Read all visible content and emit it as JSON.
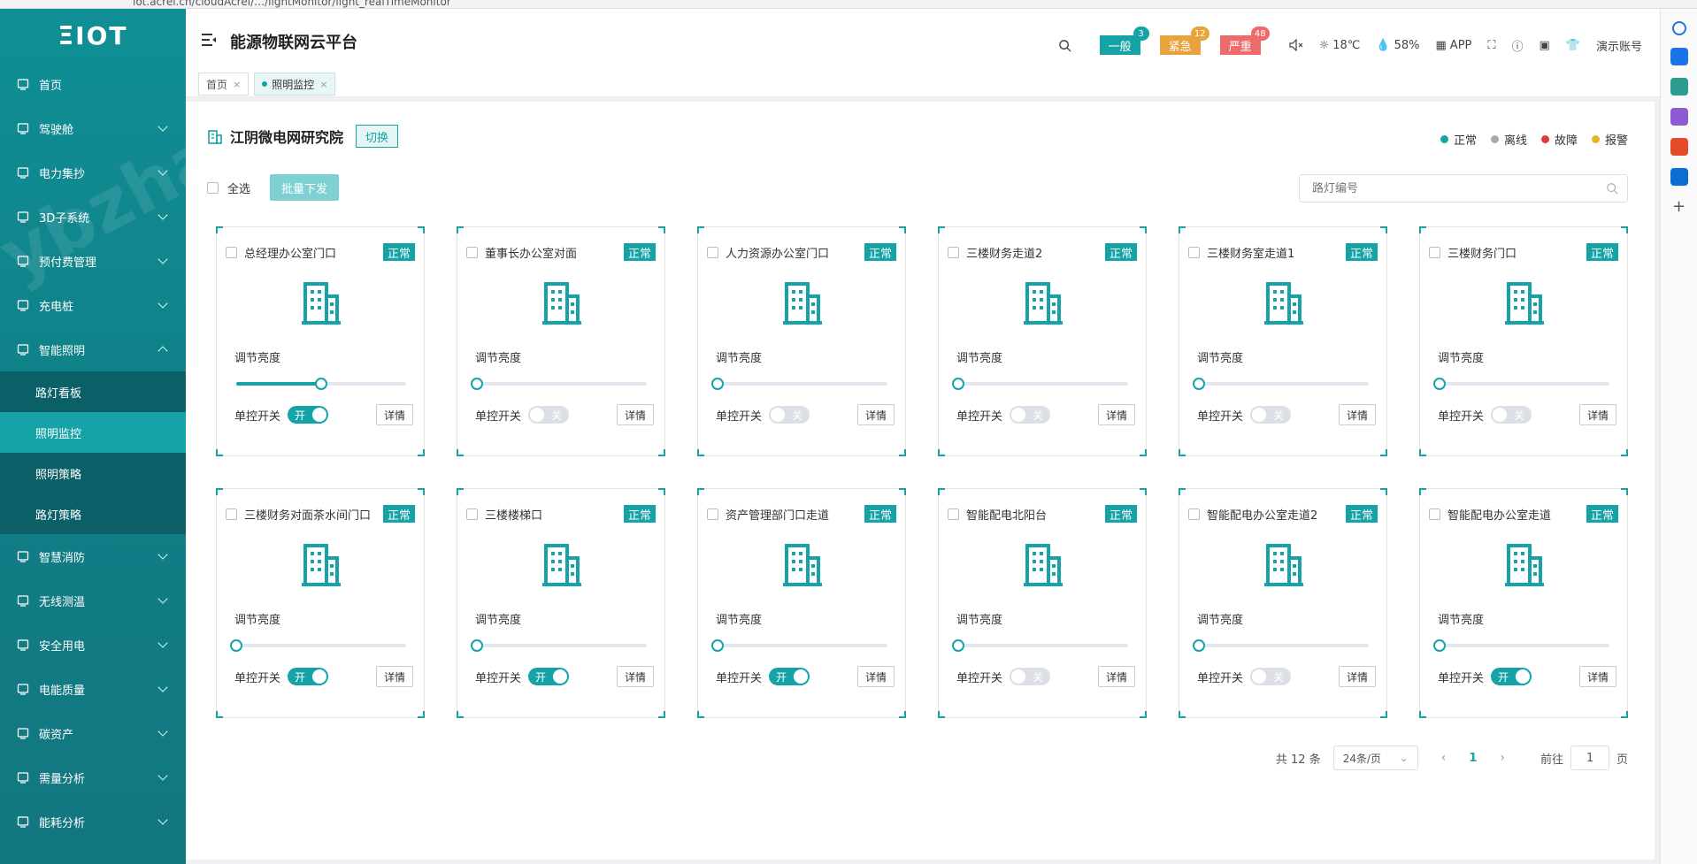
{
  "browser": {
    "url": "iot.acrel.cn/cloudAcrel/…/lightMonitor/light_realTimeMonitor"
  },
  "sidebar": {
    "logo": "ΞIOT",
    "items": [
      {
        "label": "首页",
        "icon": "monitor-icon",
        "has_children": false
      },
      {
        "label": "驾驶舱",
        "icon": "dashboard-icon",
        "has_children": true
      },
      {
        "label": "电力集抄",
        "icon": "meter-icon",
        "has_children": true
      },
      {
        "label": "3D子系统",
        "icon": "cube-icon",
        "has_children": true
      },
      {
        "label": "预付费管理",
        "icon": "user-pay-icon",
        "has_children": true
      },
      {
        "label": "充电桩",
        "icon": "charger-icon",
        "has_children": true
      },
      {
        "label": "智能照明",
        "icon": "bulb-icon",
        "has_children": true,
        "expanded": true
      }
    ],
    "sub_items": [
      {
        "label": "路灯看板",
        "active": false
      },
      {
        "label": "照明监控",
        "active": true
      },
      {
        "label": "照明策略",
        "active": false
      },
      {
        "label": "路灯策略",
        "active": false
      }
    ],
    "items_after": [
      {
        "label": "智慧消防",
        "icon": "fire-icon"
      },
      {
        "label": "无线测温",
        "icon": "thermometer-icon"
      },
      {
        "label": "安全用电",
        "icon": "flame-icon"
      },
      {
        "label": "电能质量",
        "icon": "wave-icon"
      },
      {
        "label": "碳资产",
        "icon": "carbon-icon"
      },
      {
        "label": "需量分析",
        "icon": "trend-icon"
      },
      {
        "label": "能耗分析",
        "icon": "bars-icon"
      }
    ]
  },
  "header": {
    "title": "能源物联网云平台",
    "tabs": [
      {
        "label": "首页",
        "active": false
      },
      {
        "label": "照明监控",
        "active": true
      }
    ],
    "alarms": [
      {
        "label": "一般",
        "count": "3",
        "color": "#16a3a8",
        "badge": "#16a3a8"
      },
      {
        "label": "紧急",
        "count": "12",
        "color": "#e8a33d",
        "badge": "#e8a33d"
      },
      {
        "label": "严重",
        "count": "48",
        "color": "#ef6b6b",
        "badge": "#ef6b6b"
      }
    ],
    "temperature": "18℃",
    "humidity": "58%",
    "app_label": "APP",
    "account": "演示账号"
  },
  "content": {
    "site_name": "江阴微电网研究院",
    "switch_label": "切换",
    "legend": [
      {
        "label": "正常",
        "color": "#16a3a8"
      },
      {
        "label": "离线",
        "color": "#aaaaaa"
      },
      {
        "label": "故障",
        "color": "#e23a3a"
      },
      {
        "label": "报警",
        "color": "#e8b320"
      }
    ],
    "select_all": "全选",
    "batch_button": "批量下发",
    "search_placeholder": "路灯编号",
    "brightness_label": "调节亮度",
    "switch_control_label": "单控开关",
    "detail_label": "详情",
    "on_text": "开",
    "off_text": "关",
    "lamps": [
      {
        "name": "总经理办公室门口",
        "status": "正常",
        "brightness": 50,
        "on": true
      },
      {
        "name": "董事长办公室对面",
        "status": "正常",
        "brightness": 0,
        "on": false
      },
      {
        "name": "人力资源办公室门口",
        "status": "正常",
        "brightness": 0,
        "on": false
      },
      {
        "name": "三楼财务走道2",
        "status": "正常",
        "brightness": 0,
        "on": false
      },
      {
        "name": "三楼财务室走道1",
        "status": "正常",
        "brightness": 0,
        "on": false
      },
      {
        "name": "三楼财务门口",
        "status": "正常",
        "brightness": 0,
        "on": false
      },
      {
        "name": "三楼财务对面茶水间门口",
        "status": "正常",
        "brightness": 0,
        "on": true
      },
      {
        "name": "三楼楼梯口",
        "status": "正常",
        "brightness": 0,
        "on": true
      },
      {
        "name": "资产管理部门口走道",
        "status": "正常",
        "brightness": 0,
        "on": true
      },
      {
        "name": "智能配电北阳台",
        "status": "正常",
        "brightness": 0,
        "on": false
      },
      {
        "name": "智能配电办公室走道2",
        "status": "正常",
        "brightness": 0,
        "on": false
      },
      {
        "name": "智能配电办公室走道",
        "status": "正常",
        "brightness": 0,
        "on": true
      }
    ],
    "pager": {
      "total": "共 12 条",
      "page_size": "24条/页",
      "current": "1",
      "goto_label": "前往",
      "goto_value": "1",
      "page_unit": "页"
    }
  },
  "watermark": "ybzhan.cn"
}
